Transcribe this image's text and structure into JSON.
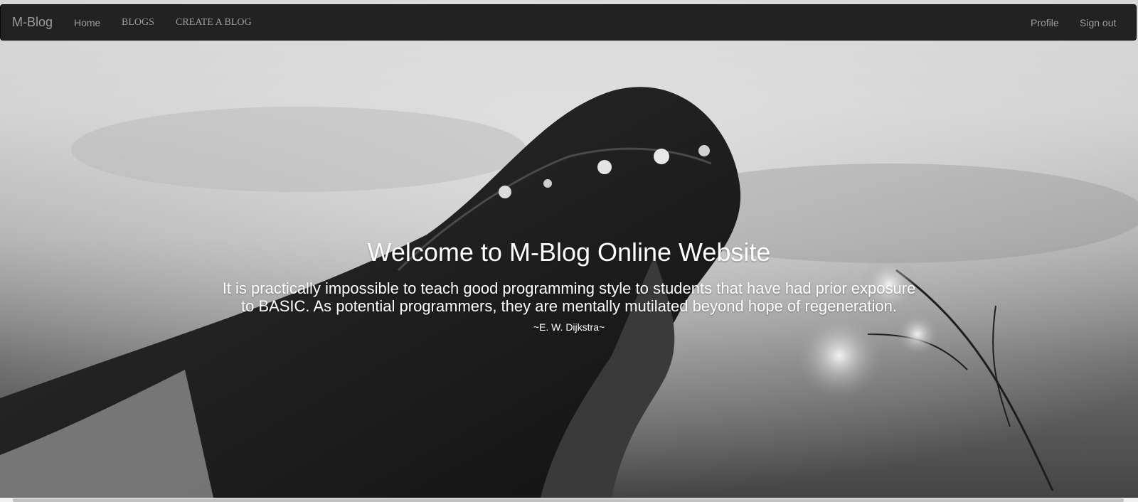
{
  "navbar": {
    "brand": "M-Blog",
    "left_links": [
      "Home",
      "BLOGS",
      "CREATE A BLOG"
    ],
    "right_links": [
      "Profile",
      "Sign out"
    ]
  },
  "hero": {
    "title": "Welcome to M-Blog Online Website",
    "quote": "It is practically impossible to teach good programming style to students that have had prior exposure to BASIC. As potential programmers, they are mentally mutilated beyond hope of regeneration.",
    "author": "~E. W. Dijkstra~",
    "image_icon": "hero-photo"
  },
  "colors": {
    "navbar_bg": "#222222",
    "nav_text": "#9d9d9d",
    "hero_text": "#ffffff"
  }
}
